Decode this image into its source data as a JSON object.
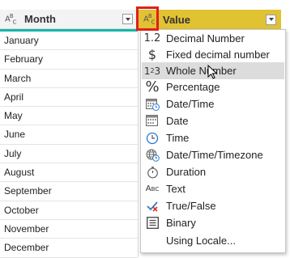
{
  "columns": {
    "month": {
      "title": "Month",
      "type_icon": "text-type-icon"
    },
    "value": {
      "title": "Value",
      "type_icon": "text-type-icon"
    }
  },
  "rows": [
    "January",
    "February",
    "March",
    "April",
    "May",
    "June",
    "July",
    "August",
    "September",
    "October",
    "November",
    "December"
  ],
  "type_menu": {
    "items": [
      {
        "label": "Decimal Number",
        "icon": "decimal-number-icon",
        "glyph": "1.2"
      },
      {
        "label": "Fixed decimal number",
        "icon": "dollar-icon",
        "glyph": "$"
      },
      {
        "label": "Whole Number",
        "icon": "whole-number-icon",
        "glyph": "123",
        "highlighted": true
      },
      {
        "label": "Percentage",
        "icon": "percent-icon",
        "glyph": "%"
      },
      {
        "label": "Date/Time",
        "icon": "calendar-clock-icon"
      },
      {
        "label": "Date",
        "icon": "calendar-icon"
      },
      {
        "label": "Time",
        "icon": "clock-icon"
      },
      {
        "label": "Date/Time/Timezone",
        "icon": "globe-clock-icon"
      },
      {
        "label": "Duration",
        "icon": "stopwatch-icon"
      },
      {
        "label": "Text",
        "icon": "text-type-icon"
      },
      {
        "label": "True/False",
        "icon": "true-false-icon"
      },
      {
        "label": "Binary",
        "icon": "binary-icon"
      },
      {
        "label": "Using Locale...",
        "icon": ""
      }
    ]
  },
  "colors": {
    "selected_header": "#e1c233",
    "highlight_box": "#e0201b",
    "quality_bar": "#17b6a8"
  }
}
